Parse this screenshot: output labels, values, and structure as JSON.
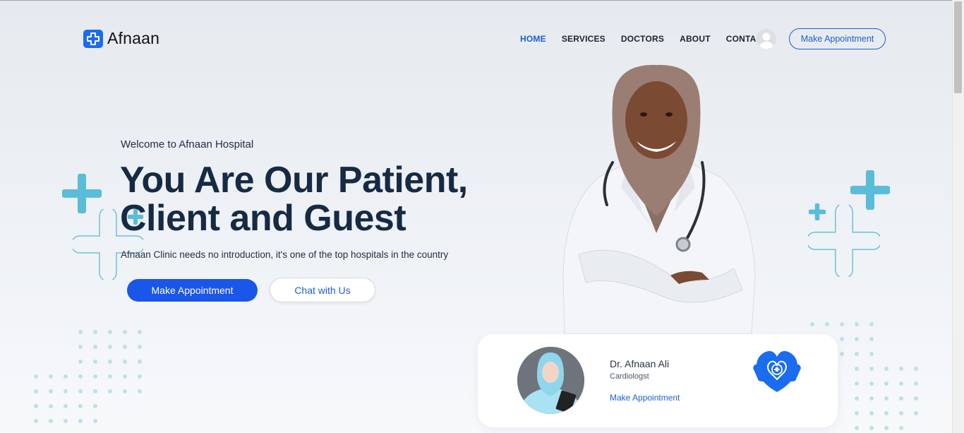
{
  "brand": {
    "name": "Afnaan",
    "accent": "#1a56e8"
  },
  "nav": {
    "items": [
      {
        "label": "HOME",
        "active": true
      },
      {
        "label": "SERVICES",
        "active": false
      },
      {
        "label": "DOCTORS",
        "active": false
      },
      {
        "label": "ABOUT",
        "active": false
      },
      {
        "label": "CONTACT",
        "active": false
      }
    ],
    "cta_label": "Make Appointment"
  },
  "hero": {
    "welcome": "Welcome to Afnaan Hospital",
    "title_line1": "You Are Our Patient,",
    "title_line2": "Client and Guest",
    "subtitle": "Afnaan Clinic needs no introduction, it's one of the top hospitals in the country",
    "primary_button": "Make Appointment",
    "secondary_button": "Chat with Us"
  },
  "doctor_card": {
    "name": "Dr. Afnaan Ali",
    "role": "Cardiologst",
    "link": "Make Appointment"
  },
  "icons": {
    "logo": "medical-cross-icon",
    "avatar": "user-avatar-icon",
    "card": "heart-care-icon"
  }
}
